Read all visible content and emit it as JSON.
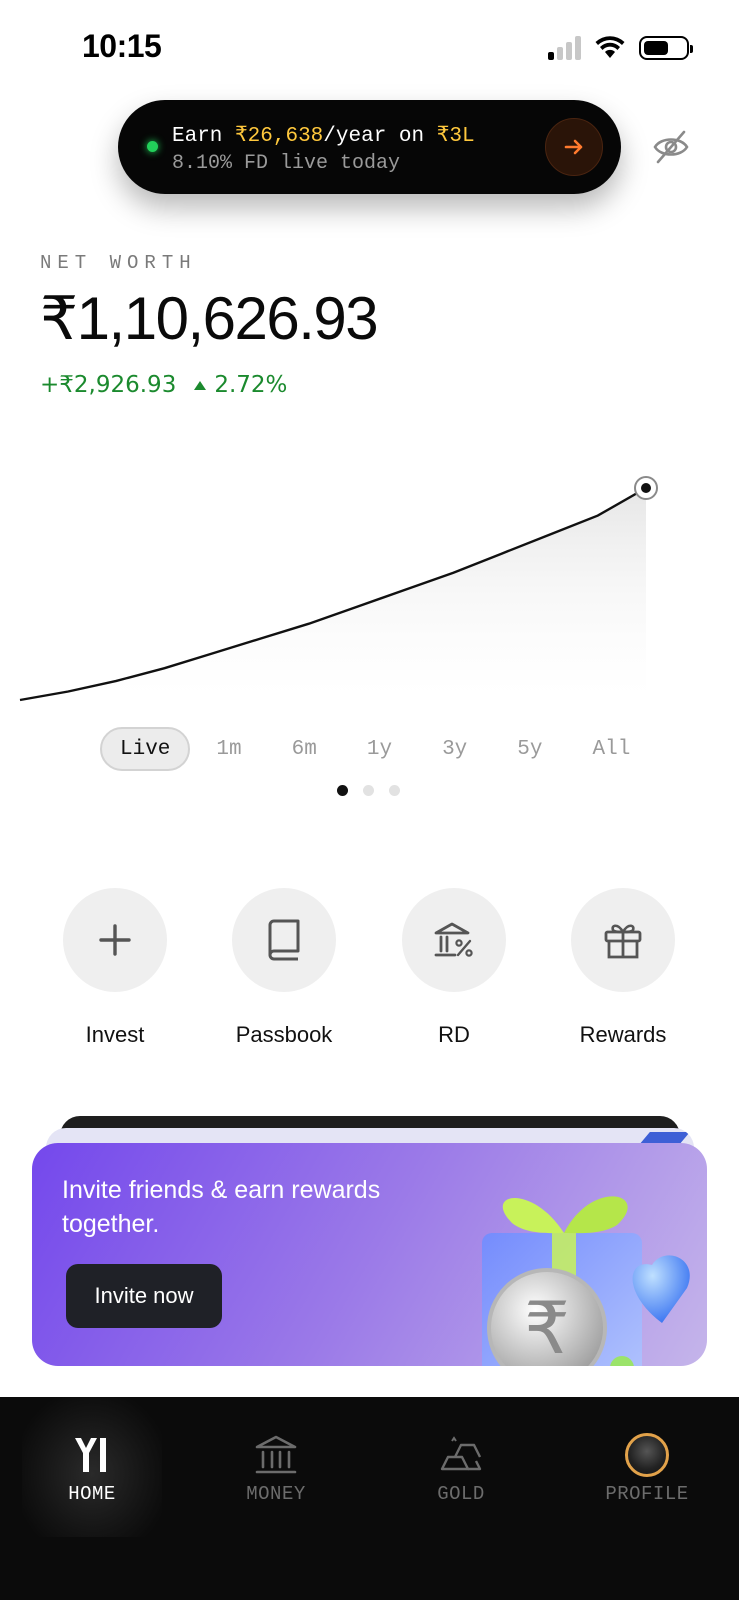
{
  "status_bar": {
    "time": "10:15"
  },
  "promo": {
    "earn_prefix": "Earn ",
    "earn_amount": "₹26,638",
    "earn_mid": "/year on ",
    "earn_principal": "₹3L",
    "subtitle": "8.10% FD live today",
    "arrow_icon": "arrow-right-icon",
    "accent_color": "#ffc83d"
  },
  "net_worth": {
    "label": "NET WORTH",
    "value": "₹1,10,626.93",
    "change_amount": "+₹2,926.93",
    "change_pct": "2.72%",
    "positive_color": "#1b8a2e"
  },
  "chart_data": {
    "type": "area",
    "title": "",
    "xlabel": "",
    "ylabel": "",
    "grid": false,
    "note_range": "Live",
    "y": [
      0.0,
      0.04,
      0.09,
      0.15,
      0.22,
      0.29,
      0.36,
      0.44,
      0.52,
      0.6,
      0.69,
      0.78,
      0.87,
      1.0
    ]
  },
  "range_tabs": [
    "Live",
    "1m",
    "6m",
    "1y",
    "3y",
    "5y",
    "All"
  ],
  "range_selected": "Live",
  "quick_actions": [
    {
      "label": "Invest",
      "icon": "plus-icon"
    },
    {
      "label": "Passbook",
      "icon": "book-icon"
    },
    {
      "label": "RD",
      "icon": "bank-percent-icon"
    },
    {
      "label": "Rewards",
      "icon": "gift-icon"
    }
  ],
  "invite": {
    "title": "Invite friends & earn rewards together.",
    "button": "Invite now"
  },
  "nav": [
    {
      "label": "HOME",
      "icon": "logo-icon",
      "active": true
    },
    {
      "label": "MONEY",
      "icon": "bank-icon",
      "active": false
    },
    {
      "label": "GOLD",
      "icon": "gold-bars-icon",
      "active": false
    },
    {
      "label": "PROFILE",
      "icon": "avatar-icon",
      "active": false
    }
  ]
}
